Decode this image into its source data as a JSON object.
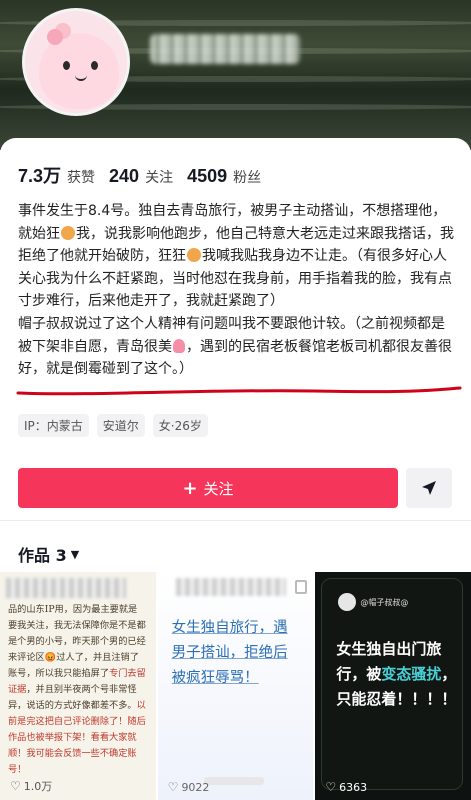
{
  "profile": {
    "stats": [
      {
        "value": "7.3万",
        "label": "获赞"
      },
      {
        "value": "240",
        "label": "关注"
      },
      {
        "value": "4509",
        "label": "粉丝"
      }
    ],
    "bio": {
      "line1a": "事件发生于8.4号。独自去青岛旅行，被男子主动搭讪，不想搭理他，就始狂",
      "line1b": "我，说我影响他跑步，他自己特意大老远走过来跟我搭话，我拒绝了他就开始破防，狂狂",
      "line1c": "我喊我贴我身边不让走。（有很多好心人关心我为什么不赶紧跑，当时他怼在我身前，用手指着我的脸，我有点寸步难行，后来他走开了，我就赶紧跑了）",
      "line2a": "帽子叔叔说过了这个人精神有问题叫我不要跟他计较。（之前视频都是被下架非自愿，青岛很美",
      "line2b": "，遇到的民宿老板餐馆老板司机都很友善很好，就是倒霉碰到了这个。）"
    },
    "tags": [
      "IP：内蒙古",
      "安道尔",
      "女·26岁"
    ],
    "follow_label": "关注",
    "follow_plus": "+"
  },
  "works": {
    "tab_label": "作品 3",
    "caret": "▼",
    "items": [
      {
        "text_a": "品的山东IP用，因为最主要就是要我关注，我无法保障你是不是都是个男的小号，昨天那个男的已经来评论区",
        "text_red1": "😡",
        "text_b": "过人了，并且注销了账号，所以我只能掐屏了",
        "text_red2": "专门去留证据",
        "text_c": "，并且别半夜两个号非常怪异，说话的方式好像都差不多。",
        "text_d": "以前是完这把自己评论删除了！随后作品也被举报下架！看看大家就顺！我可能会反馈一些不确定账号！",
        "likes": "1.0万"
      },
      {
        "text_a": "女生独自旅行，遇男子搭讪，拒绝后被疯狂辱骂！",
        "likes": "9022"
      },
      {
        "handle": "@帽子叔叔@",
        "text_a": "女生独自出门旅行，被",
        "text_hl": "变态骚扰",
        "text_b": "，只能忍着！！！！",
        "likes": "6363"
      }
    ]
  },
  "icons": {
    "share": "share-icon",
    "heart": "♡"
  },
  "colors": {
    "accent": "#f5355a",
    "underline": "#d0021b",
    "highlight": "#49d0d6"
  }
}
